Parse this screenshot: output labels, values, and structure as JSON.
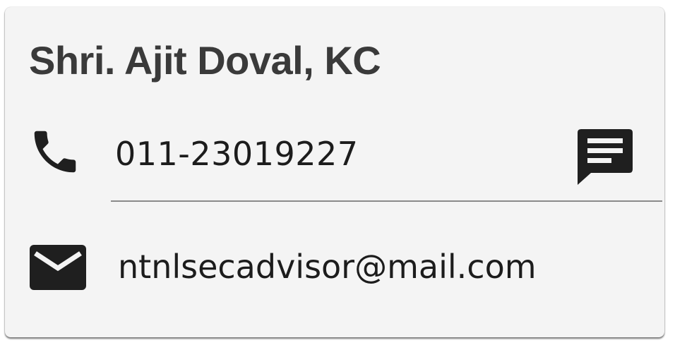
{
  "contact": {
    "name": "Shri. Ajit Doval, KC",
    "phone": "011-23019227",
    "email": "ntnlsecadvisor@mail.com"
  },
  "icons": {
    "phone": "phone-icon",
    "message": "message-icon",
    "email": "mail-icon"
  },
  "colors": {
    "card_background": "#f4f4f4",
    "icon": "#1f1f1f",
    "name_text": "#3a3a3a",
    "divider": "#8a8a8a"
  }
}
